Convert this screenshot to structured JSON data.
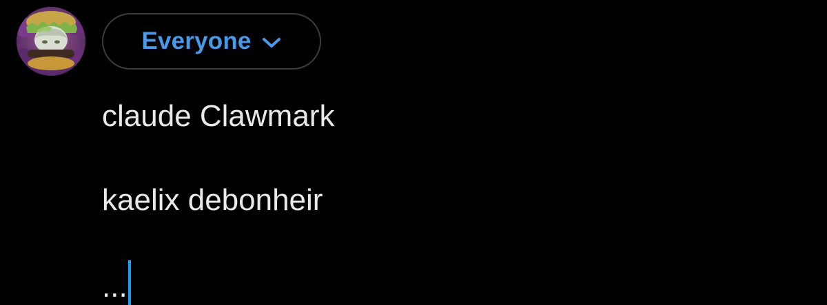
{
  "composer": {
    "audience_label": "Everyone",
    "lines": [
      "claude Clawmark",
      "kaelix debonheir",
      "..."
    ],
    "accent_color": "#4a99e9",
    "caret_color": "#1d9bf0",
    "text_color": "#e7e9ea",
    "background_color": "#000000"
  },
  "icons": {
    "audience_dropdown": "chevron-down-icon",
    "avatar": "user-avatar"
  }
}
